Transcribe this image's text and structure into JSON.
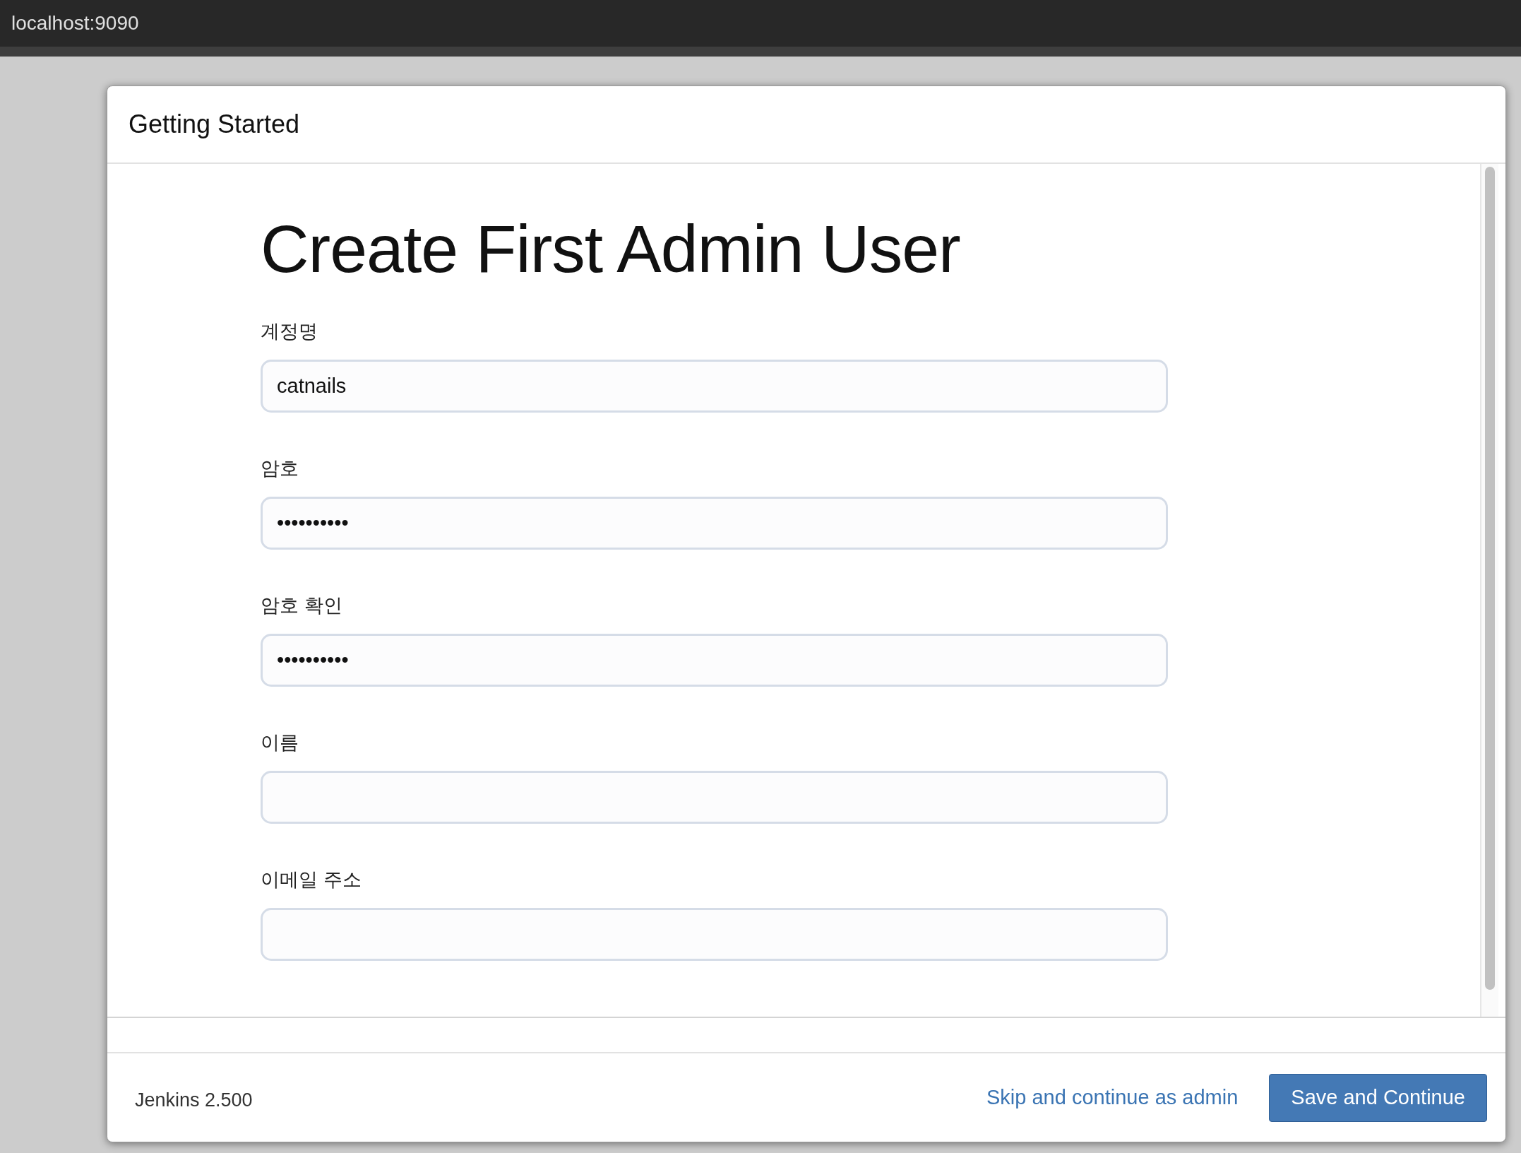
{
  "browser": {
    "address": "localhost:9090"
  },
  "dialog": {
    "title": "Getting Started",
    "heading": "Create First Admin User",
    "fields": [
      {
        "label": "계정명",
        "value": "catnails"
      },
      {
        "label": "암호",
        "value": "••••••••••"
      },
      {
        "label": "암호 확인",
        "value": "••••••••••"
      },
      {
        "label": "이름"
      },
      {
        "label": "이메일 주소"
      }
    ],
    "footer": {
      "version": "Jenkins 2.500",
      "link": "Skip and continue as admin",
      "button": "Save and Continue"
    }
  }
}
